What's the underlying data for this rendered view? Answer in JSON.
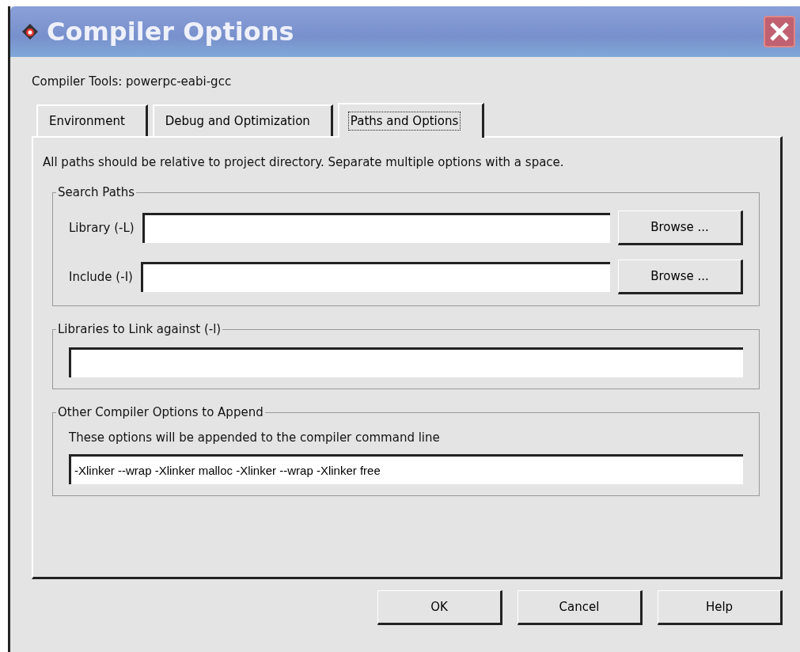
{
  "window": {
    "title": "Compiler Options"
  },
  "compiler_tools": "Compiler Tools: powerpc-eabi-gcc",
  "tabs": [
    {
      "label": "Environment",
      "selected": false
    },
    {
      "label": "Debug and Optimization",
      "selected": false
    },
    {
      "label": "Paths and Options",
      "selected": true
    }
  ],
  "description": "All paths should be relative to project directory. Separate multiple options with a space.",
  "search_paths": {
    "title": "Search Paths",
    "rows": [
      {
        "label": "Library (-L)",
        "browse": "Browse ..."
      },
      {
        "label": "Include (-I)",
        "browse": "Browse ..."
      }
    ]
  },
  "libraries": {
    "title": "Libraries to Link against (-l)"
  },
  "other_options": {
    "title": "Other Compiler Options to Append",
    "hint": "These options will be appended to the compiler command line",
    "value": "-Xlinker --wrap -Xlinker malloc -Xlinker --wrap -Xlinker free"
  },
  "buttons": [
    "OK",
    "Cancel",
    "Help"
  ]
}
